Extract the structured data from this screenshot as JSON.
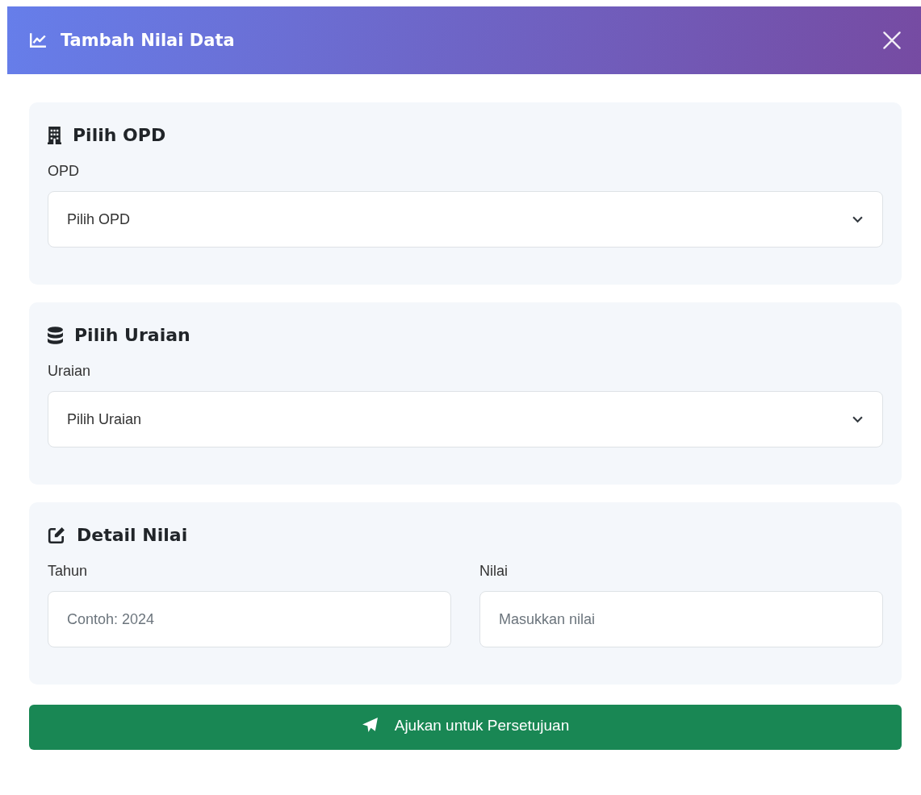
{
  "modal": {
    "title": "Tambah Nilai Data"
  },
  "sections": [
    {
      "title": "Pilih OPD",
      "fields": [
        {
          "kind": "select",
          "label": "OPD",
          "value": "Pilih OPD"
        }
      ]
    },
    {
      "title": "Pilih Uraian",
      "fields": [
        {
          "kind": "select",
          "label": "Uraian",
          "value": "Pilih Uraian"
        }
      ]
    },
    {
      "title": "Detail Nilai",
      "fields": [
        {
          "kind": "input",
          "label": "Tahun",
          "placeholder": "Contoh: 2024"
        },
        {
          "kind": "input",
          "label": "Nilai",
          "placeholder": "Masukkan nilai"
        }
      ]
    }
  ],
  "submit_button": {
    "label": "Ajukan untuk Persetujuan"
  }
}
